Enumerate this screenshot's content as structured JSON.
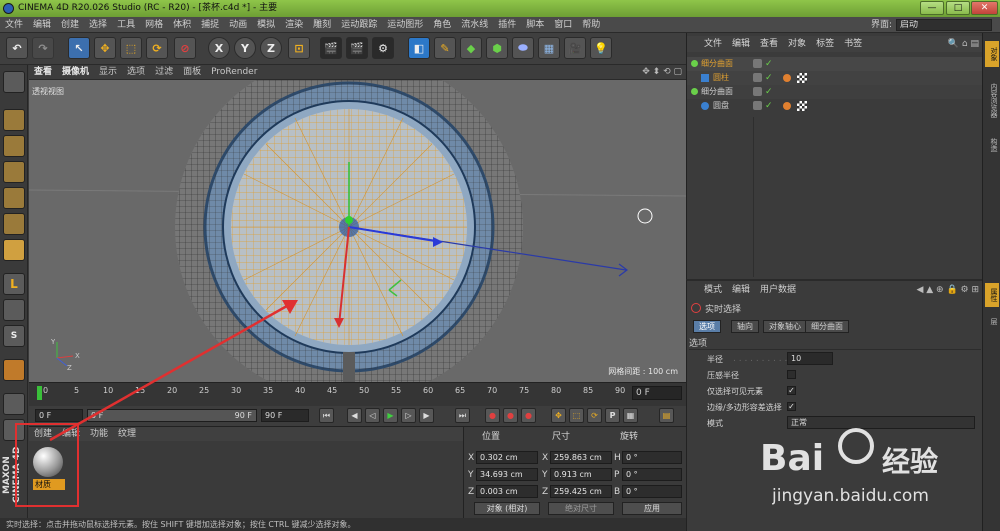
{
  "window": {
    "title": "CINEMA 4D R20.026 Studio (RC - R20) - [茶杯.c4d *] - 主要",
    "buttons": [
      "—",
      "□",
      "✕"
    ]
  },
  "menubar": {
    "items": [
      "文件",
      "编辑",
      "创建",
      "选择",
      "工具",
      "网格",
      "体积",
      "捕捉",
      "动画",
      "模拟",
      "渲染",
      "雕刻",
      "运动跟踪",
      "运动图形",
      "角色",
      "流水线",
      "插件",
      "脚本",
      "窗口",
      "帮助"
    ],
    "interface_label": "界面:",
    "interface_value": "启动"
  },
  "toolbar": {
    "axis_x": "X",
    "axis_y": "Y",
    "axis_z": "Z"
  },
  "viewport": {
    "menu": [
      "查看",
      "摄像机",
      "显示",
      "选项",
      "过滤",
      "面板",
      "ProRender"
    ],
    "view_label": "透视视图",
    "grid_label": "网格间距 : 100 cm",
    "axis_y": "Y",
    "axis_x": "X",
    "axis_z": "Z"
  },
  "timeline": {
    "ticks": [
      "0",
      "5",
      "10",
      "15",
      "20",
      "25",
      "30",
      "35",
      "40",
      "45",
      "50",
      "55",
      "60",
      "65",
      "70",
      "75",
      "80",
      "85",
      "90"
    ],
    "current_frame": "0 F",
    "start_field": "0 F",
    "range_start": "0 F",
    "range_end": "90 F",
    "end_field": "90 F"
  },
  "material_panel": {
    "tabs": [
      "创建",
      "编辑",
      "功能",
      "纹理"
    ],
    "material_name": "材质"
  },
  "coord_panel": {
    "headers": [
      "位置",
      "尺寸",
      "旋转"
    ],
    "rows": [
      {
        "axis": "X",
        "pos": "0.302 cm",
        "size_axis": "X",
        "size": "259.863 cm",
        "rot_axis": "H",
        "rot": "0 °"
      },
      {
        "axis": "Y",
        "pos": "34.693 cm",
        "size_axis": "Y",
        "size": "0.913 cm",
        "rot_axis": "P",
        "rot": "0 °"
      },
      {
        "axis": "Z",
        "pos": "0.003 cm",
        "size_axis": "Z",
        "size": "259.425 cm",
        "rot_axis": "B",
        "rot": "0 °"
      }
    ],
    "mode_select": "对象 (相对)",
    "size_select": "绝对尺寸",
    "apply_button": "应用"
  },
  "statusbar": {
    "text": "实时选择：点击并拖动鼠标选择元素。按住 SHIFT 键增加选择对象；按住 CTRL 键减少选择对象。"
  },
  "object_manager": {
    "menu": [
      "文件",
      "编辑",
      "查看",
      "对象",
      "标签",
      "书签"
    ],
    "objects": [
      {
        "name": "细分曲面",
        "color": "#e0a030",
        "indent": 0
      },
      {
        "name": "圆柱",
        "color": "#e0a030",
        "indent": 1
      },
      {
        "name": "细分曲面",
        "color": "#cfcfcf",
        "indent": 0
      },
      {
        "name": "圆盘",
        "color": "#cfcfcf",
        "indent": 1
      }
    ]
  },
  "attribute_manager": {
    "menu": [
      "模式",
      "编辑",
      "用户数据"
    ],
    "tool_name": "实时选择",
    "tabs": [
      "选项",
      "轴向",
      "对象轴心",
      "细分曲面"
    ],
    "section": "选项",
    "props": {
      "radius_label": "半径",
      "radius_value": "10",
      "pressure_label": "压感半径",
      "visible_only_label": "仅选择可见元素",
      "edge_poly_label": "边缘/多边形容差选择",
      "mode_label": "模式",
      "mode_value": "正常"
    }
  },
  "right_strip": {
    "tabs": [
      "对象",
      "内容浏览器",
      "构造",
      "属性",
      "层"
    ]
  },
  "watermark": {
    "brand": "Bai",
    "brand_cn": "经验",
    "url": "jingyan.baidu.com"
  },
  "colors": {
    "selection_orange": "#e0a030",
    "annotation_red": "#e03030",
    "active_tab_blue": "#5a7ea8"
  }
}
